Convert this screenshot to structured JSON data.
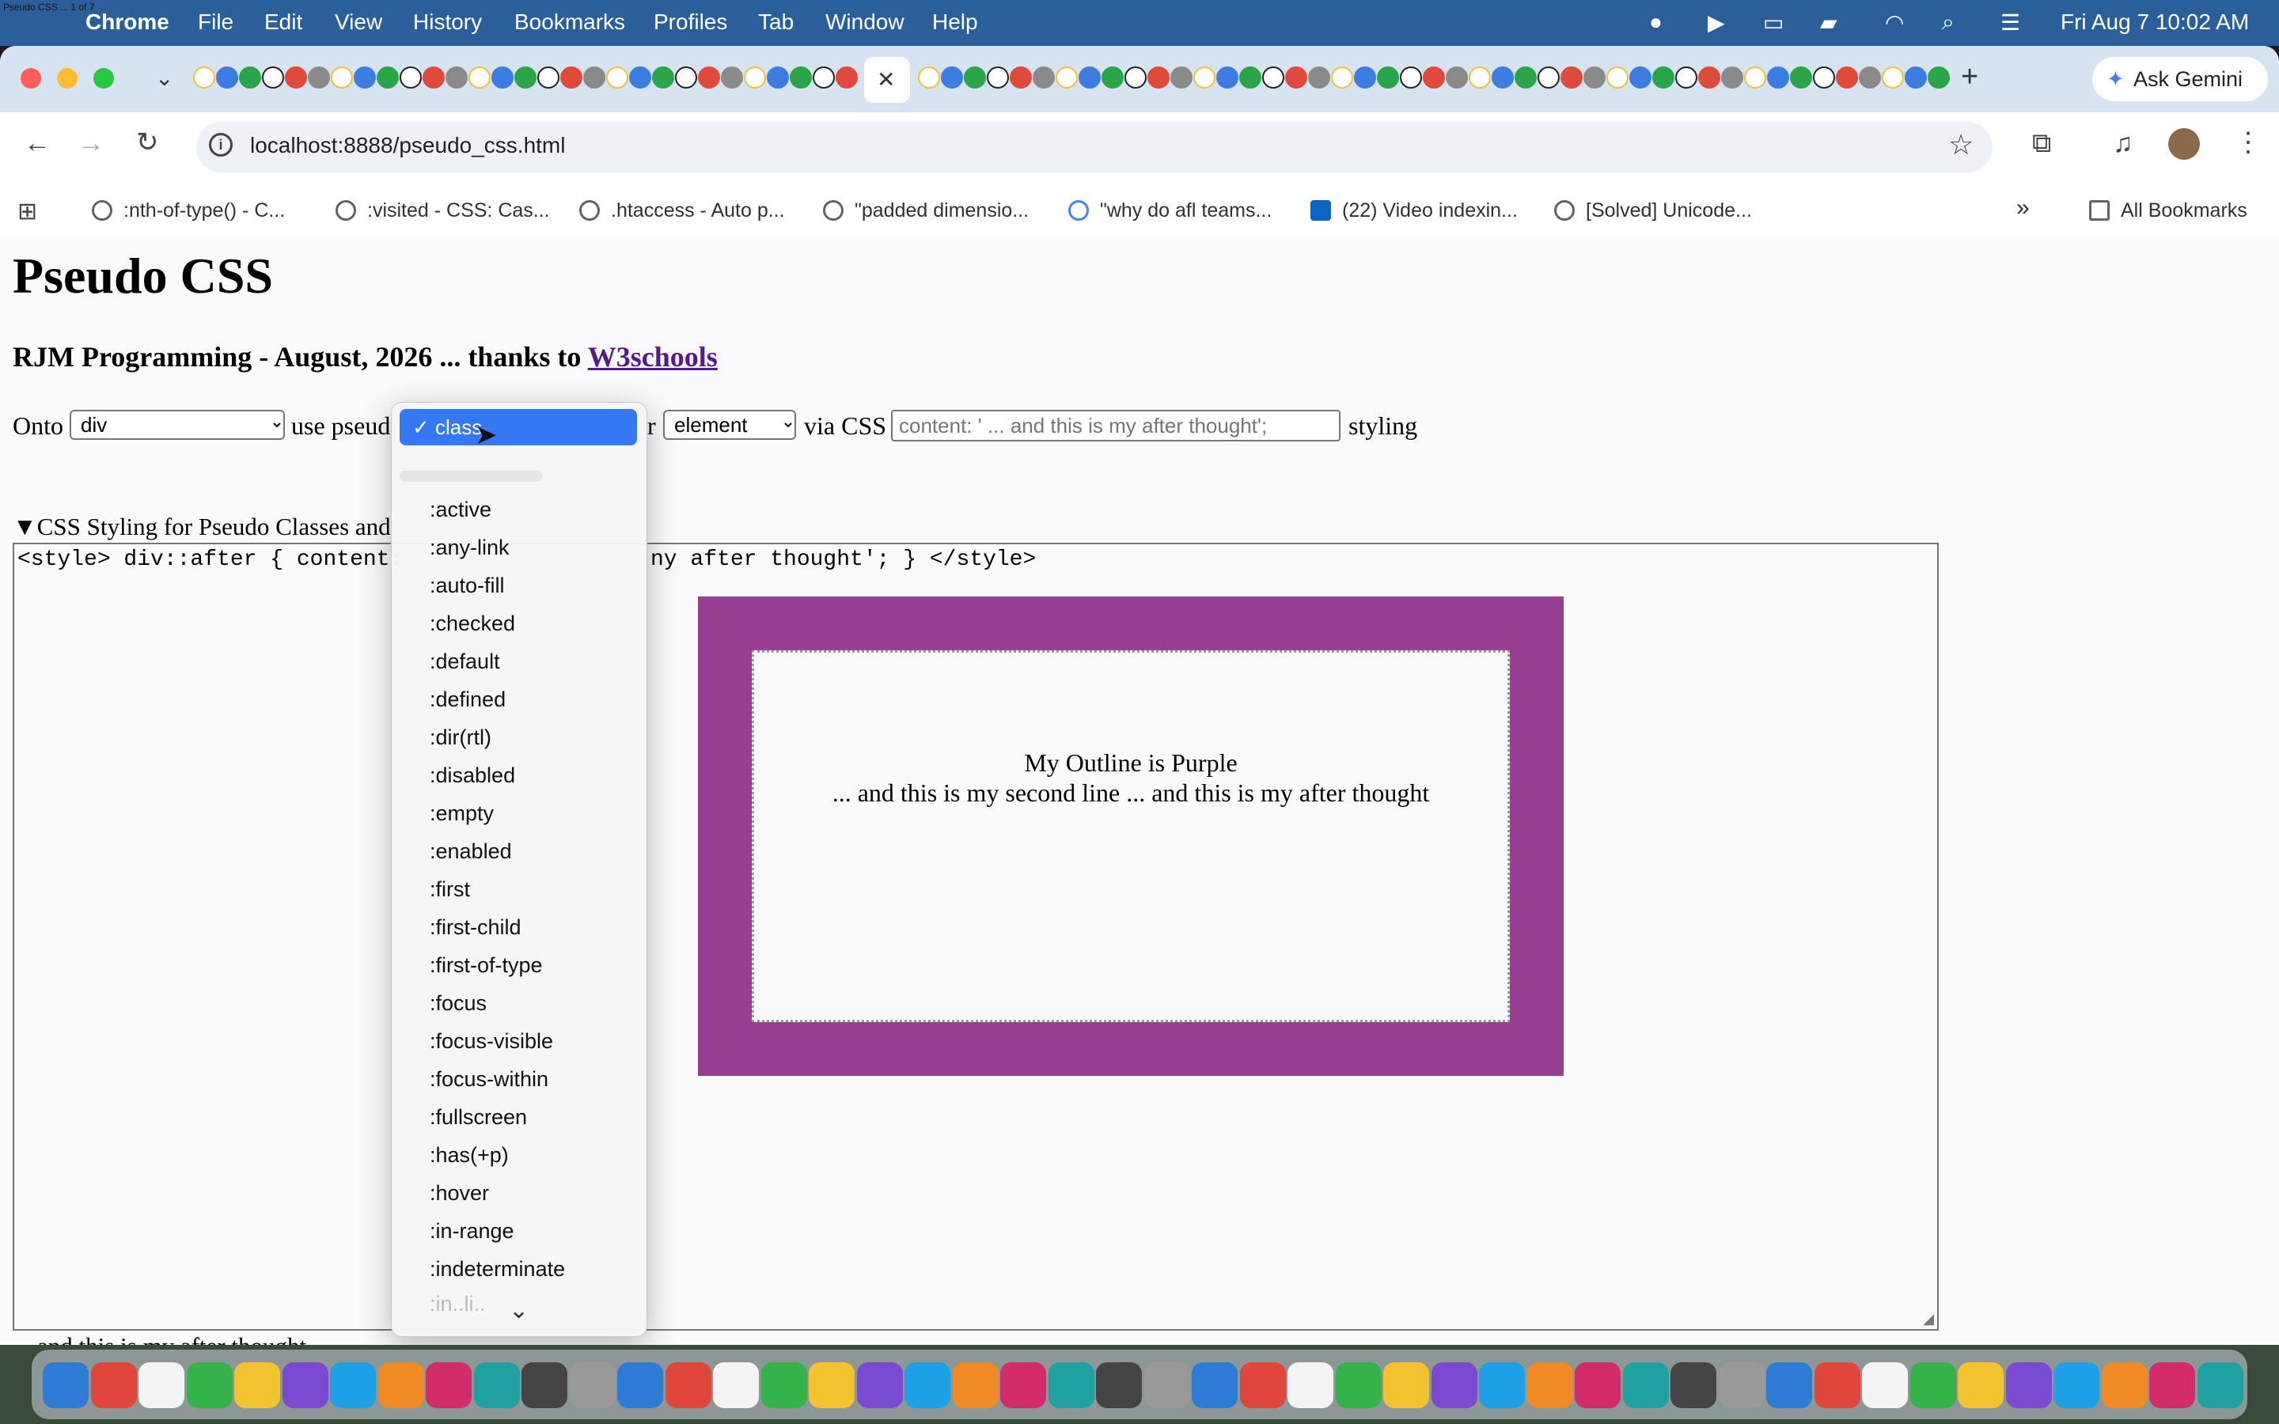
{
  "menubar": {
    "app": "Chrome",
    "items": [
      "File",
      "Edit",
      "View",
      "History",
      "Bookmarks",
      "Profiles",
      "Tab",
      "Window",
      "Help"
    ],
    "datetime": "Fri Aug 7  10:02 AM",
    "tiny_title": "Pseudo CSS ... 1 of 7"
  },
  "tabs": {
    "close_glyph": "✕",
    "new_tab_glyph": "+",
    "ask_gemini": "Ask Gemini"
  },
  "toolbar": {
    "url": "localhost:8888/pseudo_css.html"
  },
  "bookmarks": {
    "items": [
      ":nth-of-type() - C...",
      ":visited - CSS: Cas...",
      ".htaccess - Auto p...",
      "\"padded dimensio...",
      "\"why do afl teams...",
      "(22) Video indexin...",
      "[Solved] Unicode..."
    ],
    "overflow": "»",
    "all": "All Bookmarks"
  },
  "page": {
    "title": "Pseudo CSS",
    "subtitle_prefix": "RJM Programming - August, 2026 ... thanks to ",
    "subtitle_link": "W3schools",
    "onto_label": "Onto",
    "onto_value": "div",
    "use_label": "use pseud",
    "or_label": "r",
    "kind_value": "element",
    "via_label": "via CSS",
    "css_placeholder": "content: ' ... and this is my after thought';",
    "styling_label": "styling",
    "details_summary": "CSS Styling for Pseudo Classes and",
    "code_left": "<style> div::after {  content:",
    "code_right": "ny after thought'; } </style>",
    "demo_line1": "My Outline is Purple",
    "demo_line2": "... and this is my second line ... and this is my after thought",
    "footer_text": "... and this is my after thought",
    "demo_color": "#993f93"
  },
  "dropdown": {
    "selected": "class",
    "check": "✓",
    "options": [
      ":active",
      ":any-link",
      ":auto-fill",
      ":checked",
      ":default",
      ":defined",
      ":dir(rtl)",
      ":disabled",
      ":empty",
      ":enabled",
      ":first",
      ":first-child",
      ":first-of-type",
      ":focus",
      ":focus-visible",
      ":focus-within",
      ":fullscreen",
      ":has(+p)",
      ":hover",
      ":in-range",
      ":indeterminate"
    ],
    "scroll_glyph": "⌄",
    "accent": "#3478f6"
  }
}
